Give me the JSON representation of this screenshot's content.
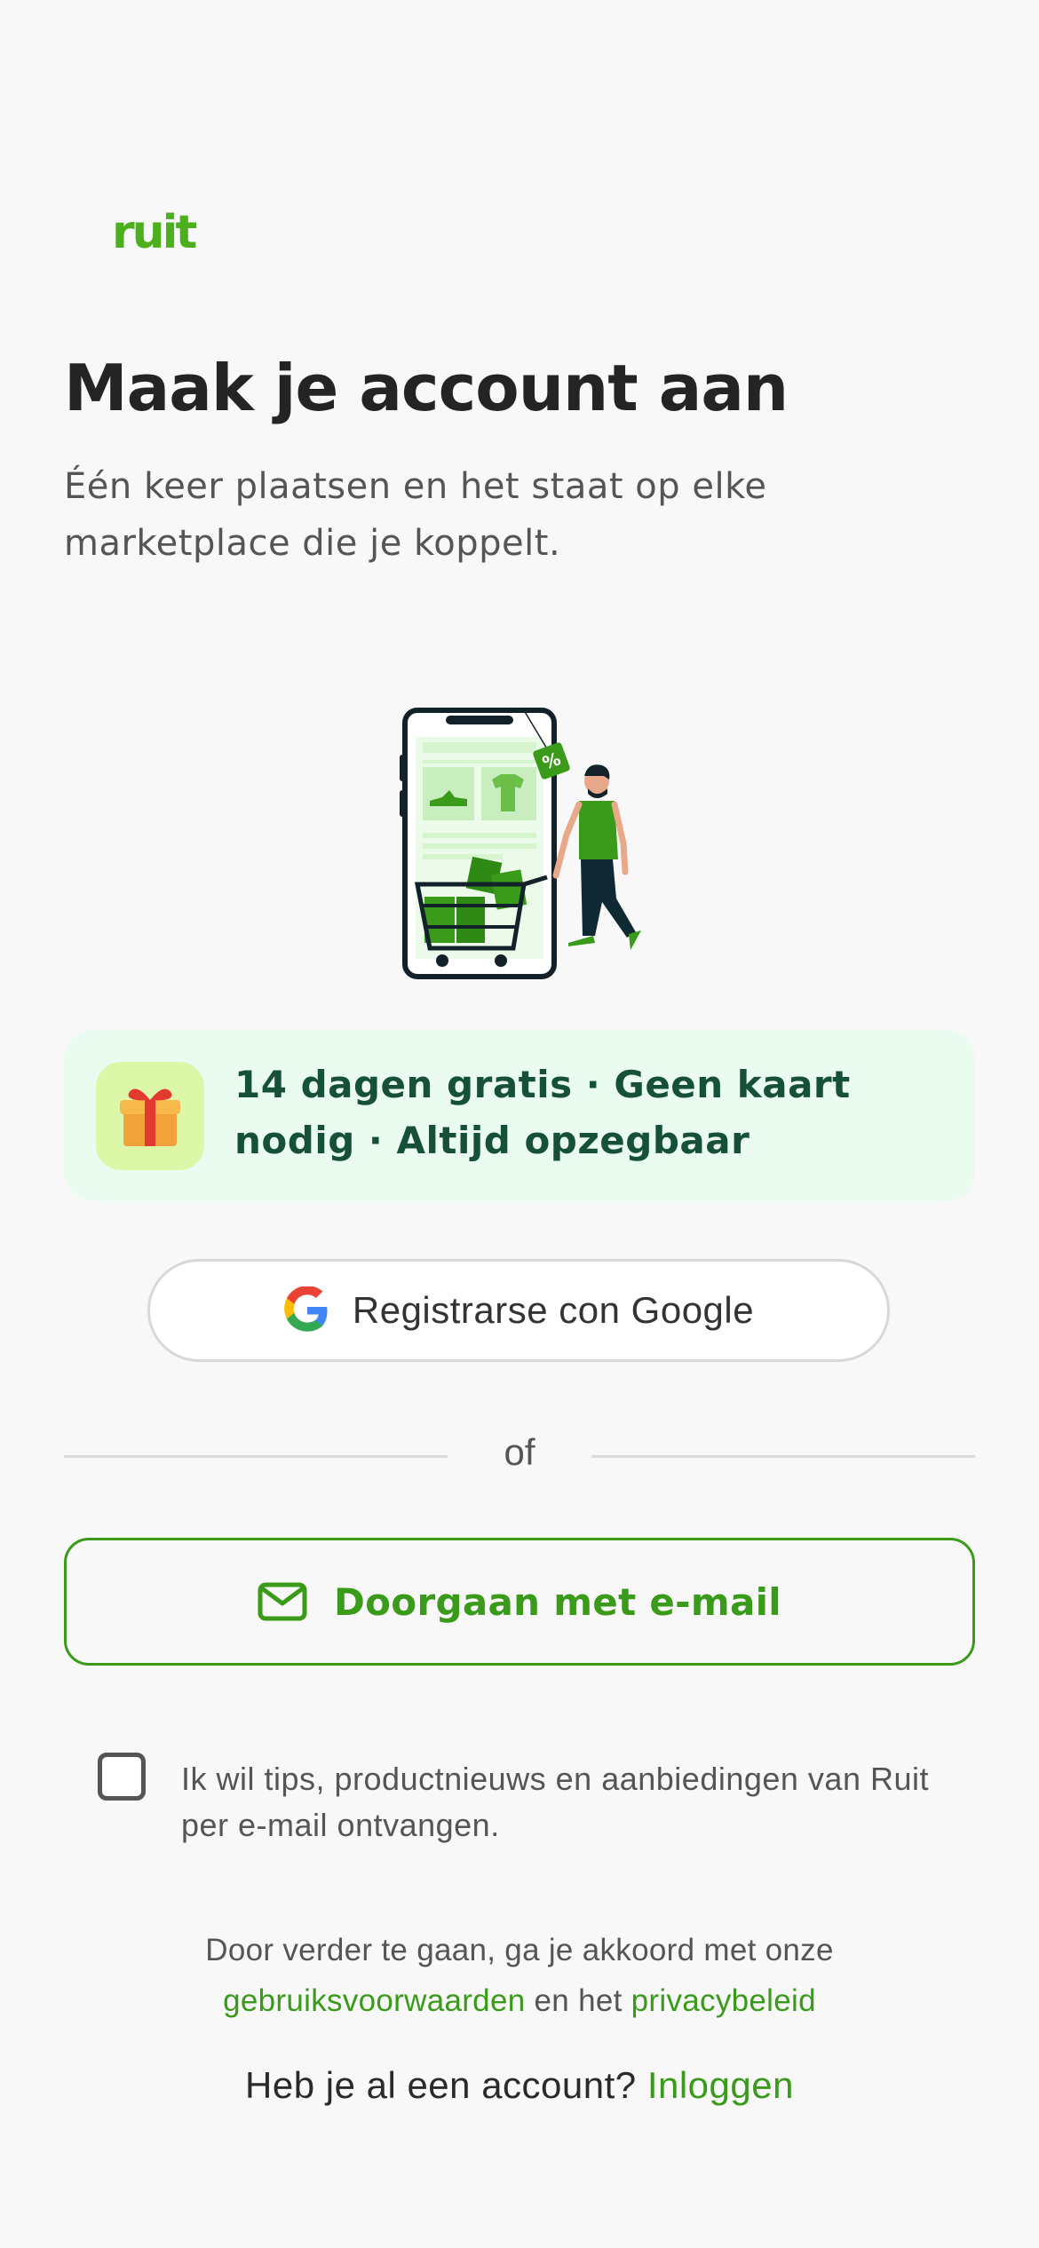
{
  "brand": {
    "logo_text": "ruit",
    "accent_color": "#3a9a1a"
  },
  "header": {
    "title": "Maak je account aan",
    "subtitle": "Één keer plaatsen en het staat op elke marketplace die je koppelt."
  },
  "illustration": {
    "icon": "shopping-phone-illustration",
    "tag_text": "%"
  },
  "promo": {
    "icon": "gift-icon",
    "text": "14 dagen gratis · Geen kaart nodig · Altijd opzegbaar"
  },
  "google_button": {
    "icon": "google-icon",
    "label": "Registrarse con Google"
  },
  "divider": {
    "text": "of"
  },
  "email_button": {
    "icon": "mail-icon",
    "label": "Doorgaan met e-mail"
  },
  "newsletter": {
    "checked": false,
    "label": "Ik wil tips, productnieuws en aanbiedingen van Ruit per e-mail ontvangen."
  },
  "terms": {
    "prefix": "Door verder te gaan, ga je akkoord met onze",
    "terms_link": "gebruiksvoorwaarden",
    "middle": "en het",
    "privacy_link": "privacybeleid"
  },
  "login": {
    "prompt": "Heb je al een account?",
    "link": "Inloggen"
  }
}
